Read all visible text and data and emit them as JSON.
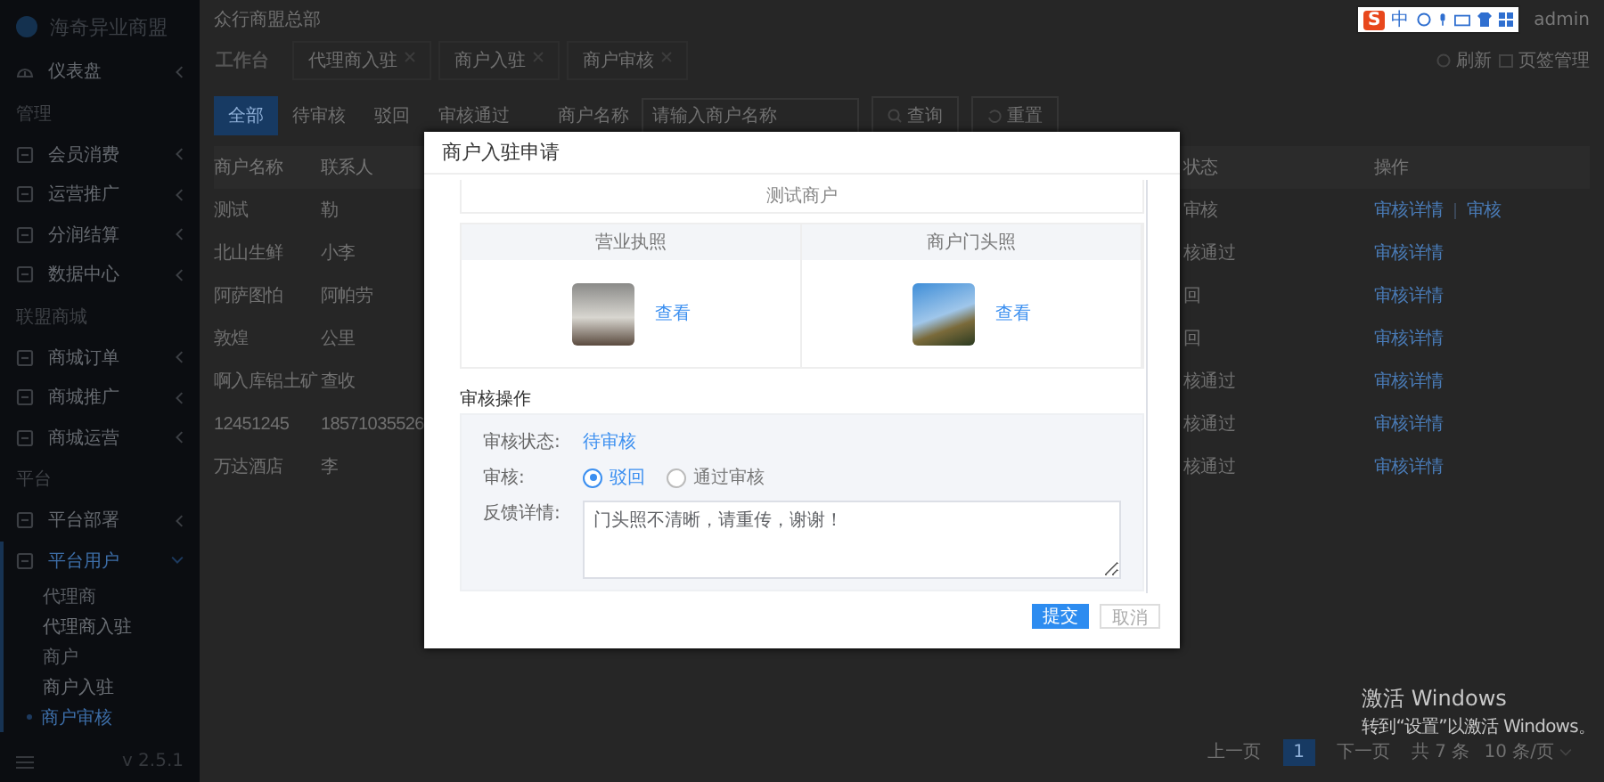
{
  "sidebar": {
    "logo": "海奇异业商盟",
    "entries": [
      {
        "kind": "item",
        "label": "仪表盘",
        "expanded": false
      },
      {
        "kind": "section",
        "label": "管理"
      },
      {
        "kind": "item",
        "label": "会员消费",
        "expanded": false
      },
      {
        "kind": "item",
        "label": "运营推广",
        "expanded": false
      },
      {
        "kind": "item",
        "label": "分润结算",
        "expanded": false
      },
      {
        "kind": "item",
        "label": "数据中心",
        "expanded": false
      },
      {
        "kind": "section",
        "label": "联盟商城"
      },
      {
        "kind": "item",
        "label": "商城订单",
        "expanded": false
      },
      {
        "kind": "item",
        "label": "商城推广",
        "expanded": false
      },
      {
        "kind": "item",
        "label": "商城运营",
        "expanded": false
      },
      {
        "kind": "section",
        "label": "平台"
      },
      {
        "kind": "item",
        "label": "平台部署",
        "expanded": false
      },
      {
        "kind": "item",
        "label": "平台用户",
        "expanded": true,
        "children": [
          {
            "kind": "header",
            "label": "代理商"
          },
          {
            "kind": "link",
            "label": "代理商入驻",
            "selected": false
          },
          {
            "kind": "header",
            "label": "商户"
          },
          {
            "kind": "link",
            "label": "商户入驻",
            "selected": false
          },
          {
            "kind": "link",
            "label": "商户审核",
            "selected": true
          }
        ]
      }
    ],
    "version": "v 2.5.1"
  },
  "header": {
    "org": "众行商盟总部",
    "user": "admin",
    "ime_toolbar": {
      "logo": "S",
      "mode": "中"
    }
  },
  "tabs": [
    {
      "label": "工作台",
      "closable": false,
      "selected": true
    },
    {
      "label": "代理商入驻",
      "closable": true,
      "selected": false
    },
    {
      "label": "商户入驻",
      "closable": true,
      "selected": false
    },
    {
      "label": "商户审核",
      "closable": true,
      "selected": false
    }
  ],
  "tab_actions": {
    "refresh": "刷新",
    "manage": "页签管理"
  },
  "filter": {
    "statuses": [
      {
        "label": "全部",
        "selected": true
      },
      {
        "label": "待审核",
        "selected": false
      },
      {
        "label": "驳回",
        "selected": false
      },
      {
        "label": "审核通过",
        "selected": false
      }
    ],
    "name_label": "商户名称",
    "name_placeholder": "请输入商户名称",
    "search_button": "查询",
    "reset_button": "重置"
  },
  "table": {
    "columns": [
      "商户名称",
      "联系人",
      "状态",
      "操作"
    ],
    "rows": [
      {
        "name": "测试",
        "contact": "勒",
        "status": "审核",
        "actions": [
          "审核详情",
          "审核"
        ]
      },
      {
        "name": "北山生鲜",
        "contact": "小李",
        "status": "核通过",
        "actions": [
          "审核详情"
        ]
      },
      {
        "name": "阿萨图怕",
        "contact": "阿帕劳",
        "status": "回",
        "actions": [
          "审核详情"
        ]
      },
      {
        "name": "敦煌",
        "contact": "公里",
        "status": "回",
        "actions": [
          "审核详情"
        ]
      },
      {
        "name": "啊入库铝土矿",
        "contact": "查收",
        "status": "核通过",
        "actions": [
          "审核详情"
        ]
      },
      {
        "name": "12451245",
        "contact": "18571035526",
        "status": "核通过",
        "actions": [
          "审核详情"
        ]
      },
      {
        "name": "万达酒店",
        "contact": "李",
        "status": "核通过",
        "actions": [
          "审核详情"
        ]
      }
    ]
  },
  "pagination": {
    "prev": "上一页",
    "pages": [
      {
        "label": "1",
        "selected": true
      }
    ],
    "next": "下一页",
    "total": "共 7 条",
    "page_size": "10 条/页"
  },
  "os_notice": {
    "title": "激活 Windows",
    "text": "转到“设置”以激活 Windows。"
  },
  "dialog": {
    "title": "商户入驻申请",
    "top_row": "测试商户",
    "documents": [
      {
        "label": "营业执照",
        "link": "查看"
      },
      {
        "label": "商户门头照",
        "link": "查看"
      }
    ],
    "review_title": "审核操作",
    "status_label": "审核状态:",
    "status_value": "待审核",
    "decision_label": "审核:",
    "options": [
      {
        "label": "驳回",
        "selected": true
      },
      {
        "label": "通过审核",
        "selected": false
      }
    ],
    "feedback_label": "反馈详情:",
    "feedback": "门头照不清晰，请重传，谢谢！",
    "submit": "提交",
    "cancel": "取消"
  }
}
